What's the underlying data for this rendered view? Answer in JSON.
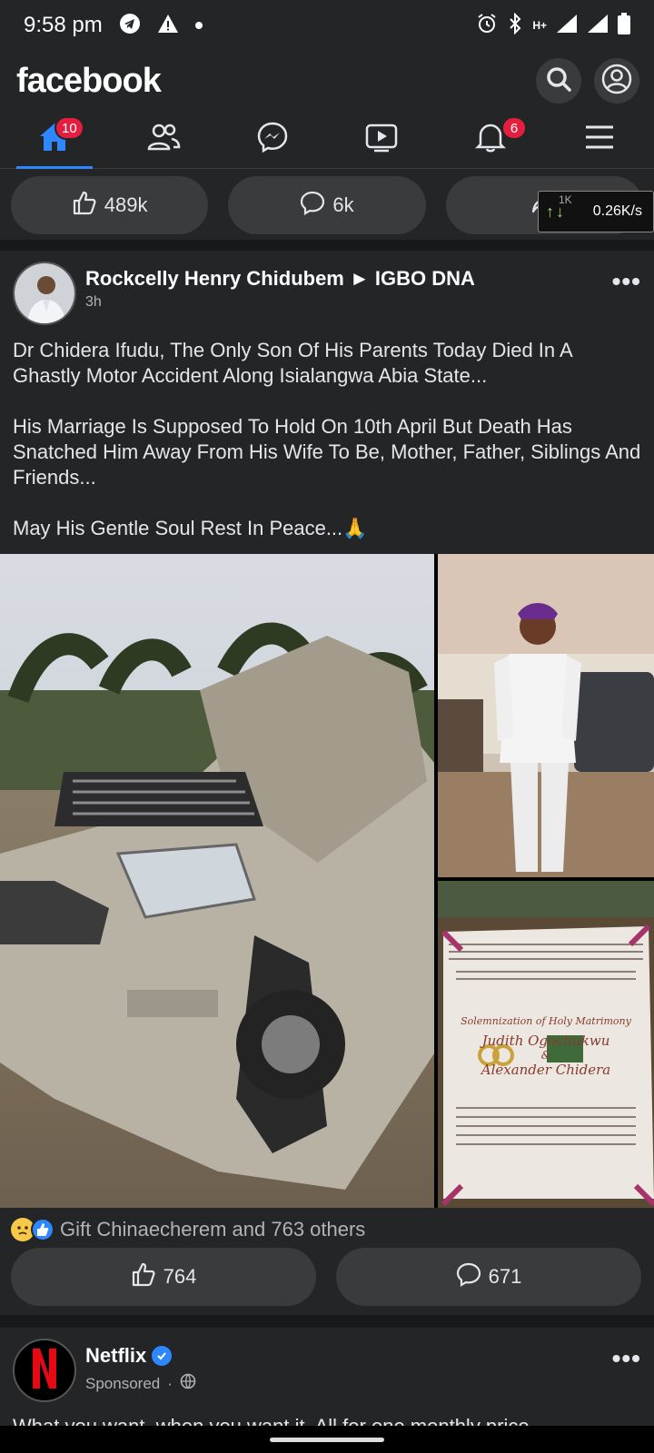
{
  "status_bar": {
    "time": "9:58 pm",
    "network_label": "H+"
  },
  "header": {
    "logo": "facebook",
    "icons": [
      "search-icon",
      "profile-icon"
    ]
  },
  "nav": {
    "home_badge": "10",
    "notifications_badge": "6",
    "items": [
      "home-icon",
      "friends-icon",
      "messenger-icon",
      "watch-icon",
      "bell-icon",
      "menu-icon"
    ]
  },
  "previous_post_actions": {
    "likes": "489k",
    "comments": "6k"
  },
  "speed_overlay": {
    "unit": "1K",
    "speed": "0.26K/s"
  },
  "post": {
    "author": "Rockcelly Henry Chidubem",
    "group": "IGBO DNA",
    "time": "3h",
    "paragraphs": [
      "Dr Chidera Ifudu, The Only Son Of His Parents Today Died In A Ghastly Motor Accident Along Isialangwa Abia State...",
      "His Marriage Is Supposed To Hold On 10th April But Death Has Snatched Him Away From His Wife To Be, Mother, Father, Siblings And Friends...",
      "May His Gentle Soul Rest In Peace...🙏"
    ],
    "invitation": {
      "line1": "Solemnization of Holy Matrimony",
      "bride": "Judith Ogochukwu",
      "and": "&",
      "groom": "Alexander Chidera"
    },
    "reactions_summary": "Gift Chinaecherem and 763 others",
    "likes": "764",
    "comments": "671"
  },
  "post2": {
    "author": "Netflix",
    "sponsored": "Sponsored",
    "text": "What you want, when you want it. All for one monthly price."
  },
  "colors": {
    "background": "#242526",
    "accent": "#2d88ff",
    "badge": "#e41e3f"
  }
}
